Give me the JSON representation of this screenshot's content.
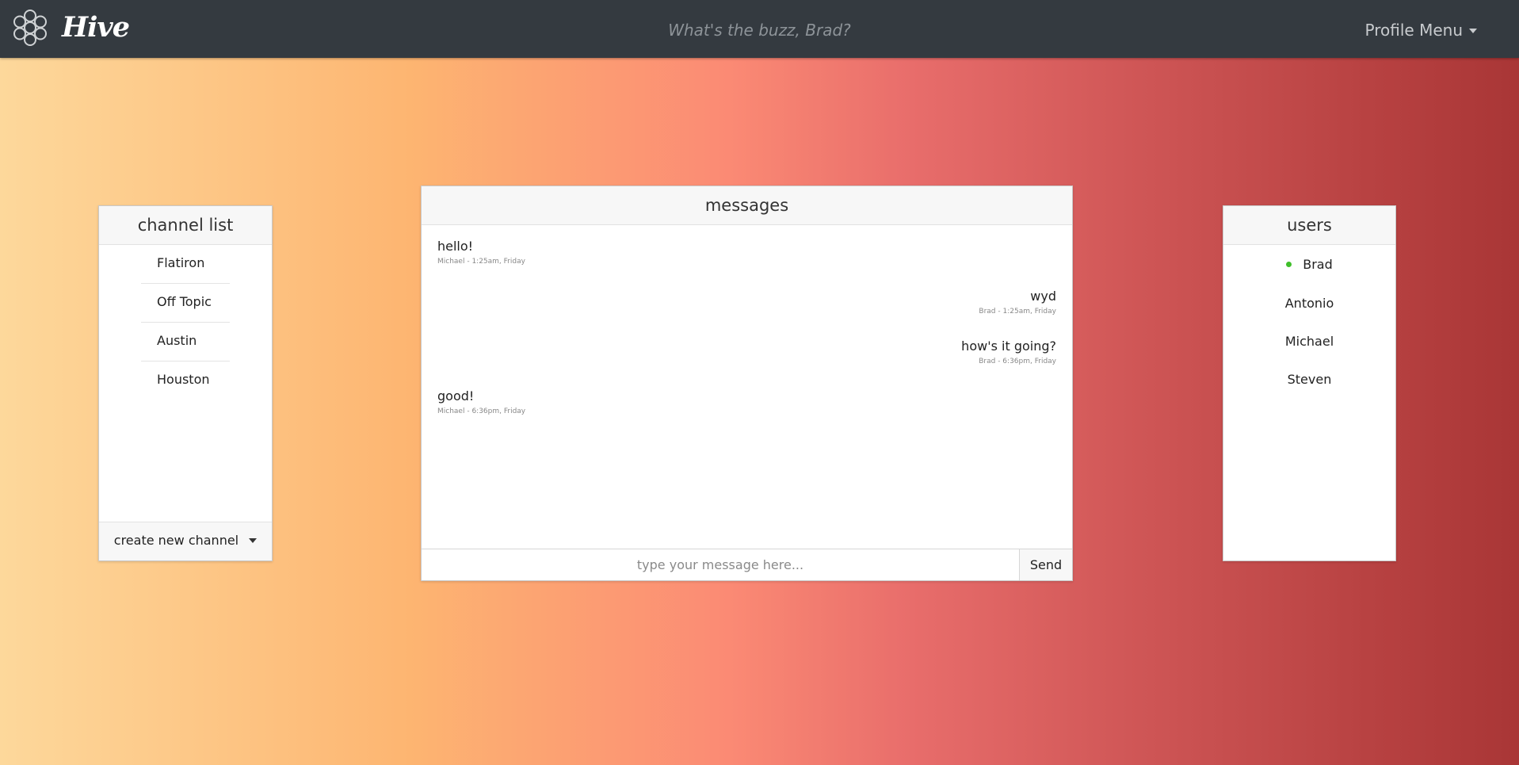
{
  "app": {
    "brand": "Hive",
    "tagline": "What's the buzz, Brad?",
    "profile_menu_label": "Profile Menu"
  },
  "channels": {
    "title": "channel list",
    "items": [
      "Flatiron",
      "Off Topic",
      "Austin",
      "Houston"
    ],
    "create_label": "create new channel"
  },
  "messages": {
    "title": "messages",
    "items": [
      {
        "text": "hello!",
        "meta": "Michael - 1:25am, Friday",
        "side": "left"
      },
      {
        "text": "wyd",
        "meta": "Brad - 1:25am, Friday",
        "side": "right"
      },
      {
        "text": "how's it going?",
        "meta": "Brad - 6:36pm, Friday",
        "side": "right"
      },
      {
        "text": "good!",
        "meta": "Michael - 6:36pm, Friday",
        "side": "left"
      }
    ],
    "input_placeholder": "type your message here...",
    "send_label": "Send"
  },
  "users": {
    "title": "users",
    "items": [
      {
        "name": "Brad",
        "online": true
      },
      {
        "name": "Antonio",
        "online": false
      },
      {
        "name": "Michael",
        "online": false
      },
      {
        "name": "Steven",
        "online": false
      }
    ]
  },
  "colors": {
    "navbar": "#343a40",
    "online": "#3fbf2a",
    "gradient_start": "#fdd89b",
    "gradient_end": "#a93636"
  }
}
